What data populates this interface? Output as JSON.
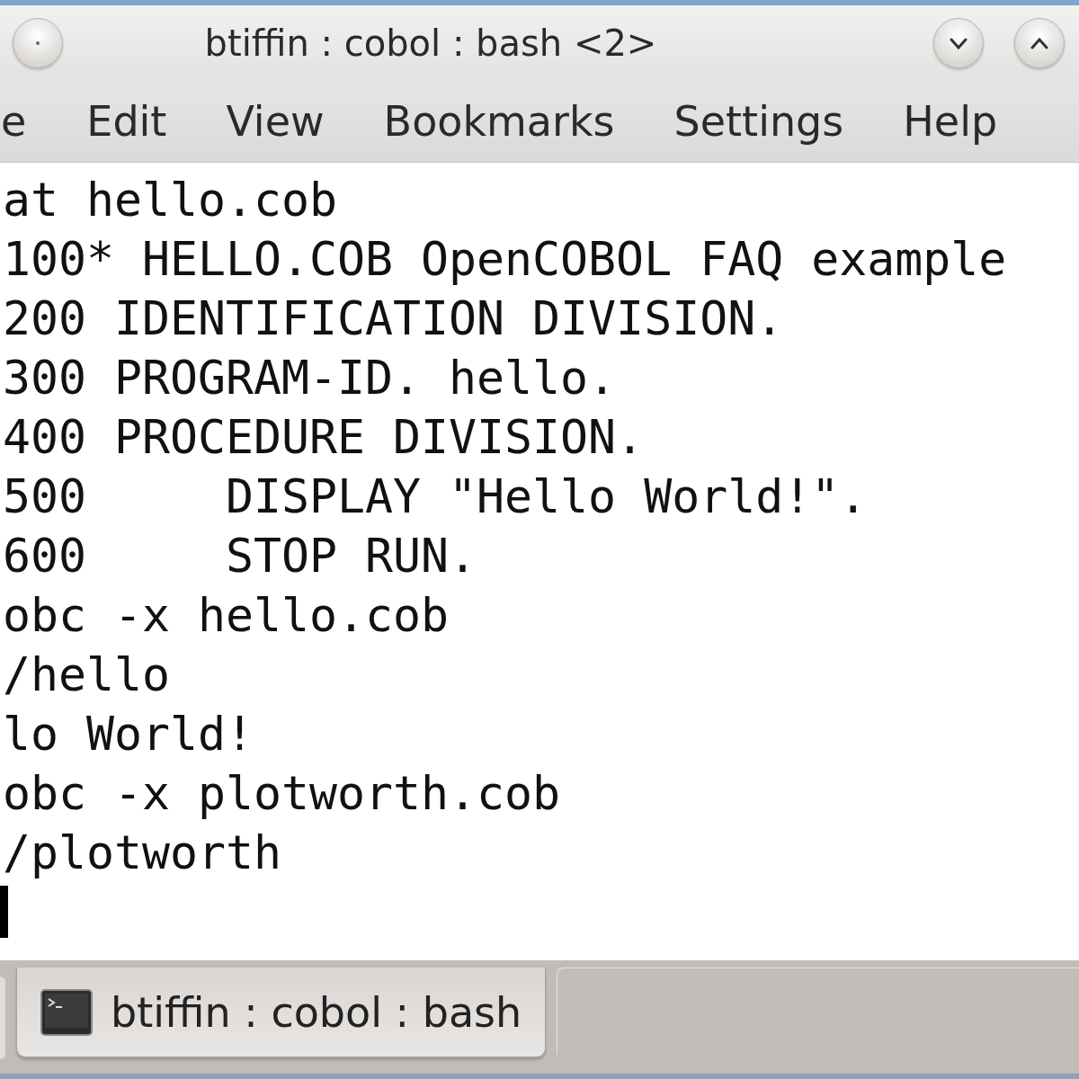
{
  "window": {
    "title": "btiffin : cobol : bash <2>"
  },
  "menu": [
    "e",
    "Edit",
    "View",
    "Bookmarks",
    "Settings",
    "Help"
  ],
  "terminal": {
    "lines": [
      "at hello.cob",
      "100* HELLO.COB OpenCOBOL FAQ example",
      "200 IDENTIFICATION DIVISION.",
      "300 PROGRAM-ID. hello.",
      "400 PROCEDURE DIVISION.",
      "500     DISPLAY \"Hello World!\".",
      "600     STOP RUN.",
      "obc -x hello.cob",
      "/hello",
      "lo World!",
      "obc -x plotworth.cob",
      "/plotworth"
    ]
  },
  "tabs": [
    {
      "label": "btiffin : cobol : bash",
      "selected": true
    }
  ]
}
